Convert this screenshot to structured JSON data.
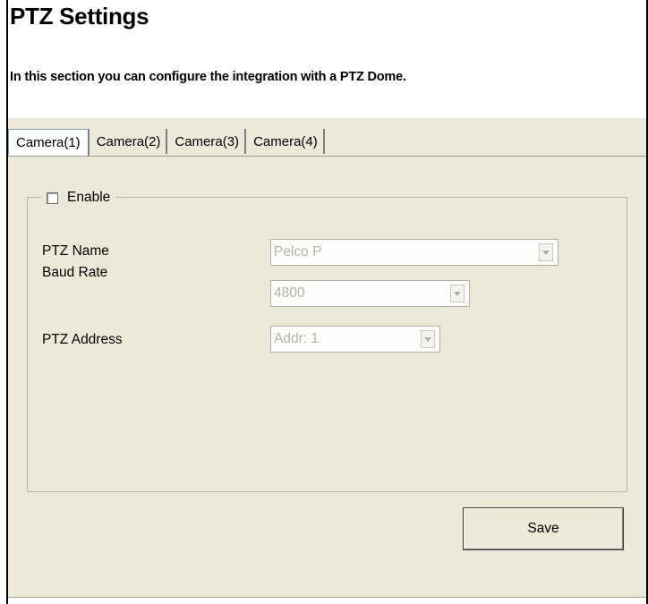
{
  "header": {
    "title": "PTZ Settings",
    "description": "In this section you can configure the integration with a PTZ Dome."
  },
  "tabs": [
    {
      "label": "Camera(1)",
      "active": true
    },
    {
      "label": "Camera(2)",
      "active": false
    },
    {
      "label": "Camera(3)",
      "active": false
    },
    {
      "label": "Camera(4)",
      "active": false
    }
  ],
  "group": {
    "enable_label": "Enable",
    "enabled": false
  },
  "fields": {
    "ptz_name": {
      "label": "PTZ Name",
      "value": "Pelco P",
      "disabled": true
    },
    "baud_rate": {
      "label": "Baud Rate",
      "value": "4800",
      "disabled": true
    },
    "ptz_address": {
      "label": "PTZ Address",
      "value": "Addr: 1",
      "disabled": true
    }
  },
  "actions": {
    "save_label": "Save"
  },
  "icons": {
    "dropdown": "chevron-down-icon"
  },
  "colors": {
    "panel_background": "#ece9d8",
    "disabled_text": "#b5b2a8"
  }
}
